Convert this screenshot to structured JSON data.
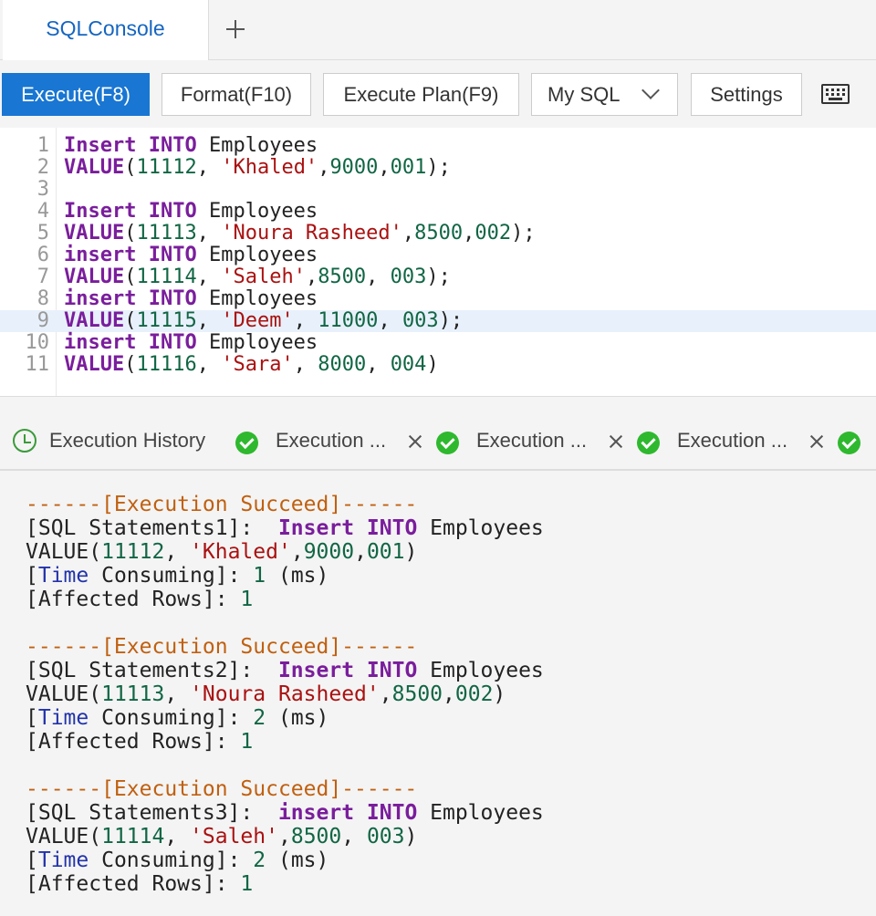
{
  "tabs": {
    "active": "SQLConsole",
    "add_icon": "plus-icon"
  },
  "toolbar": {
    "execute": "Execute(F8)",
    "format": "Format(F10)",
    "plan": "Execute Plan(F9)",
    "db": "My SQL",
    "settings": "Settings",
    "keyboard_icon": "keyboard-icon"
  },
  "editor": {
    "lines": [
      {
        "n": "1",
        "tokens": [
          [
            "kw",
            "Insert"
          ],
          [
            "t",
            " "
          ],
          [
            "kw",
            "INTO"
          ],
          [
            "t",
            " Employees"
          ]
        ]
      },
      {
        "n": "2",
        "tokens": [
          [
            "kw",
            "VALUE"
          ],
          [
            "t",
            "("
          ],
          [
            "num",
            "11112"
          ],
          [
            "t",
            ", "
          ],
          [
            "str",
            "'Khaled'"
          ],
          [
            "t",
            ","
          ],
          [
            "num",
            "9000"
          ],
          [
            "t",
            ","
          ],
          [
            "num",
            "001"
          ],
          [
            "t",
            ");"
          ]
        ]
      },
      {
        "n": "3",
        "tokens": []
      },
      {
        "n": "4",
        "tokens": [
          [
            "kw",
            "Insert"
          ],
          [
            "t",
            " "
          ],
          [
            "kw",
            "INTO"
          ],
          [
            "t",
            " Employees"
          ]
        ]
      },
      {
        "n": "5",
        "tokens": [
          [
            "kw",
            "VALUE"
          ],
          [
            "t",
            "("
          ],
          [
            "num",
            "11113"
          ],
          [
            "t",
            ", "
          ],
          [
            "str",
            "'Noura Rasheed'"
          ],
          [
            "t",
            ","
          ],
          [
            "num",
            "8500"
          ],
          [
            "t",
            ","
          ],
          [
            "num",
            "002"
          ],
          [
            "t",
            ");"
          ]
        ]
      },
      {
        "n": "6",
        "tokens": [
          [
            "kw",
            "insert"
          ],
          [
            "t",
            " "
          ],
          [
            "kw",
            "INTO"
          ],
          [
            "t",
            " Employees"
          ]
        ]
      },
      {
        "n": "7",
        "tokens": [
          [
            "kw",
            "VALUE"
          ],
          [
            "t",
            "("
          ],
          [
            "num",
            "11114"
          ],
          [
            "t",
            ", "
          ],
          [
            "str",
            "'Saleh'"
          ],
          [
            "t",
            ","
          ],
          [
            "num",
            "8500"
          ],
          [
            "t",
            ", "
          ],
          [
            "num",
            "003"
          ],
          [
            "t",
            ");"
          ]
        ]
      },
      {
        "n": "8",
        "tokens": [
          [
            "kw",
            "insert"
          ],
          [
            "t",
            " "
          ],
          [
            "kw",
            "INTO"
          ],
          [
            "t",
            " Employees"
          ]
        ]
      },
      {
        "n": "9",
        "tokens": [
          [
            "kw",
            "VALUE"
          ],
          [
            "t",
            "("
          ],
          [
            "num",
            "11115"
          ],
          [
            "t",
            ", "
          ],
          [
            "str",
            "'Deem'"
          ],
          [
            "t",
            ", "
          ],
          [
            "num",
            "11000"
          ],
          [
            "t",
            ", "
          ],
          [
            "num",
            "003"
          ],
          [
            "t",
            ");"
          ]
        ]
      },
      {
        "n": "10",
        "tokens": [
          [
            "kw",
            "insert"
          ],
          [
            "t",
            " "
          ],
          [
            "kw",
            "INTO"
          ],
          [
            "t",
            " Employees"
          ]
        ]
      },
      {
        "n": "11",
        "tokens": [
          [
            "kw",
            "VALUE"
          ],
          [
            "t",
            "("
          ],
          [
            "num",
            "11116"
          ],
          [
            "t",
            ", "
          ],
          [
            "str",
            "'Sara'"
          ],
          [
            "t",
            ", "
          ],
          [
            "num",
            "8000"
          ],
          [
            "t",
            ", "
          ],
          [
            "num",
            "004"
          ],
          [
            "t",
            ")"
          ]
        ]
      }
    ]
  },
  "panel": {
    "history": "Execution History",
    "tab_label": "Execution ..."
  },
  "results": {
    "blocks": [
      {
        "lines": [
          [
            [
              "dash",
              "------[Execution Succeed]------"
            ]
          ],
          [
            [
              "t",
              "[SQL Statements1]:  "
            ],
            [
              "kw",
              "Insert"
            ],
            [
              "t",
              " "
            ],
            [
              "kw",
              "INTO"
            ],
            [
              "t",
              " Employees"
            ]
          ],
          [
            [
              "t",
              "VALUE("
            ],
            [
              "num",
              "11112"
            ],
            [
              "t",
              ", "
            ],
            [
              "str",
              "'Khaled'"
            ],
            [
              "t",
              ","
            ],
            [
              "num",
              "9000"
            ],
            [
              "t",
              ","
            ],
            [
              "num",
              "001"
            ],
            [
              "t",
              ")"
            ]
          ],
          [
            [
              "t",
              "["
            ],
            [
              "tm",
              "Time"
            ],
            [
              "t",
              " Consuming]: "
            ],
            [
              "num",
              "1"
            ],
            [
              "t",
              " (ms)"
            ]
          ],
          [
            [
              "t",
              "[Affected Rows]: "
            ],
            [
              "num",
              "1"
            ]
          ]
        ]
      },
      {
        "lines": [
          [
            [
              "dash",
              "------[Execution Succeed]------"
            ]
          ],
          [
            [
              "t",
              "[SQL Statements2]:  "
            ],
            [
              "kw",
              "Insert"
            ],
            [
              "t",
              " "
            ],
            [
              "kw",
              "INTO"
            ],
            [
              "t",
              " Employees"
            ]
          ],
          [
            [
              "t",
              "VALUE("
            ],
            [
              "num",
              "11113"
            ],
            [
              "t",
              ", "
            ],
            [
              "str",
              "'Noura Rasheed'"
            ],
            [
              "t",
              ","
            ],
            [
              "num",
              "8500"
            ],
            [
              "t",
              ","
            ],
            [
              "num",
              "002"
            ],
            [
              "t",
              ")"
            ]
          ],
          [
            [
              "t",
              "["
            ],
            [
              "tm",
              "Time"
            ],
            [
              "t",
              " Consuming]: "
            ],
            [
              "num",
              "2"
            ],
            [
              "t",
              " (ms)"
            ]
          ],
          [
            [
              "t",
              "[Affected Rows]: "
            ],
            [
              "num",
              "1"
            ]
          ]
        ]
      },
      {
        "lines": [
          [
            [
              "dash",
              "------[Execution Succeed]------"
            ]
          ],
          [
            [
              "t",
              "[SQL Statements3]:  "
            ],
            [
              "kw",
              "insert"
            ],
            [
              "t",
              " "
            ],
            [
              "kw",
              "INTO"
            ],
            [
              "t",
              " Employees"
            ]
          ],
          [
            [
              "t",
              "VALUE("
            ],
            [
              "num",
              "11114"
            ],
            [
              "t",
              ", "
            ],
            [
              "str",
              "'Saleh'"
            ],
            [
              "t",
              ","
            ],
            [
              "num",
              "8500"
            ],
            [
              "t",
              ", "
            ],
            [
              "num",
              "003"
            ],
            [
              "t",
              ")"
            ]
          ],
          [
            [
              "t",
              "["
            ],
            [
              "tm",
              "Time"
            ],
            [
              "t",
              " Consuming]: "
            ],
            [
              "num",
              "2"
            ],
            [
              "t",
              " (ms)"
            ]
          ],
          [
            [
              "t",
              "[Affected Rows]: "
            ],
            [
              "num",
              "1"
            ]
          ]
        ]
      }
    ]
  }
}
